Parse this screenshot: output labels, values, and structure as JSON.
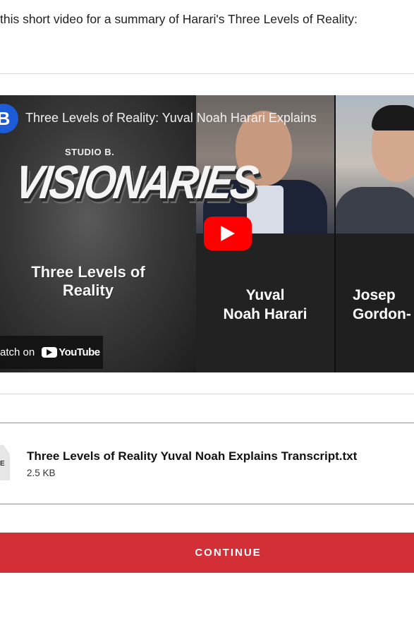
{
  "intro_text": "this short video for a summary of Harari's Three Levels of Reality:",
  "video": {
    "channel_badge": "B",
    "title": "Three Levels of Reality: Yuval Noah Harari Explains",
    "studio_label": "STUDIO B.",
    "series_label": "VISIONARIES",
    "panel_title_line1": "Three Levels of",
    "panel_title_line2": "Reality",
    "speaker1_line1": "Yuval",
    "speaker1_line2": "Noah Harari",
    "speaker2_line1": "Josep",
    "speaker2_line2": "Gordon-",
    "watch_on_label": "atch on",
    "youtube_wordmark": "YouTube",
    "play_icon": "play-icon"
  },
  "attachment": {
    "icon": "file-icon",
    "icon_label": "E",
    "file_name": "Three Levels of Reality Yuval Noah Explains Transcript.txt",
    "file_size": "2.5 KB"
  },
  "continue_button": {
    "label": "CONTINUE",
    "color": "#d32f37"
  }
}
